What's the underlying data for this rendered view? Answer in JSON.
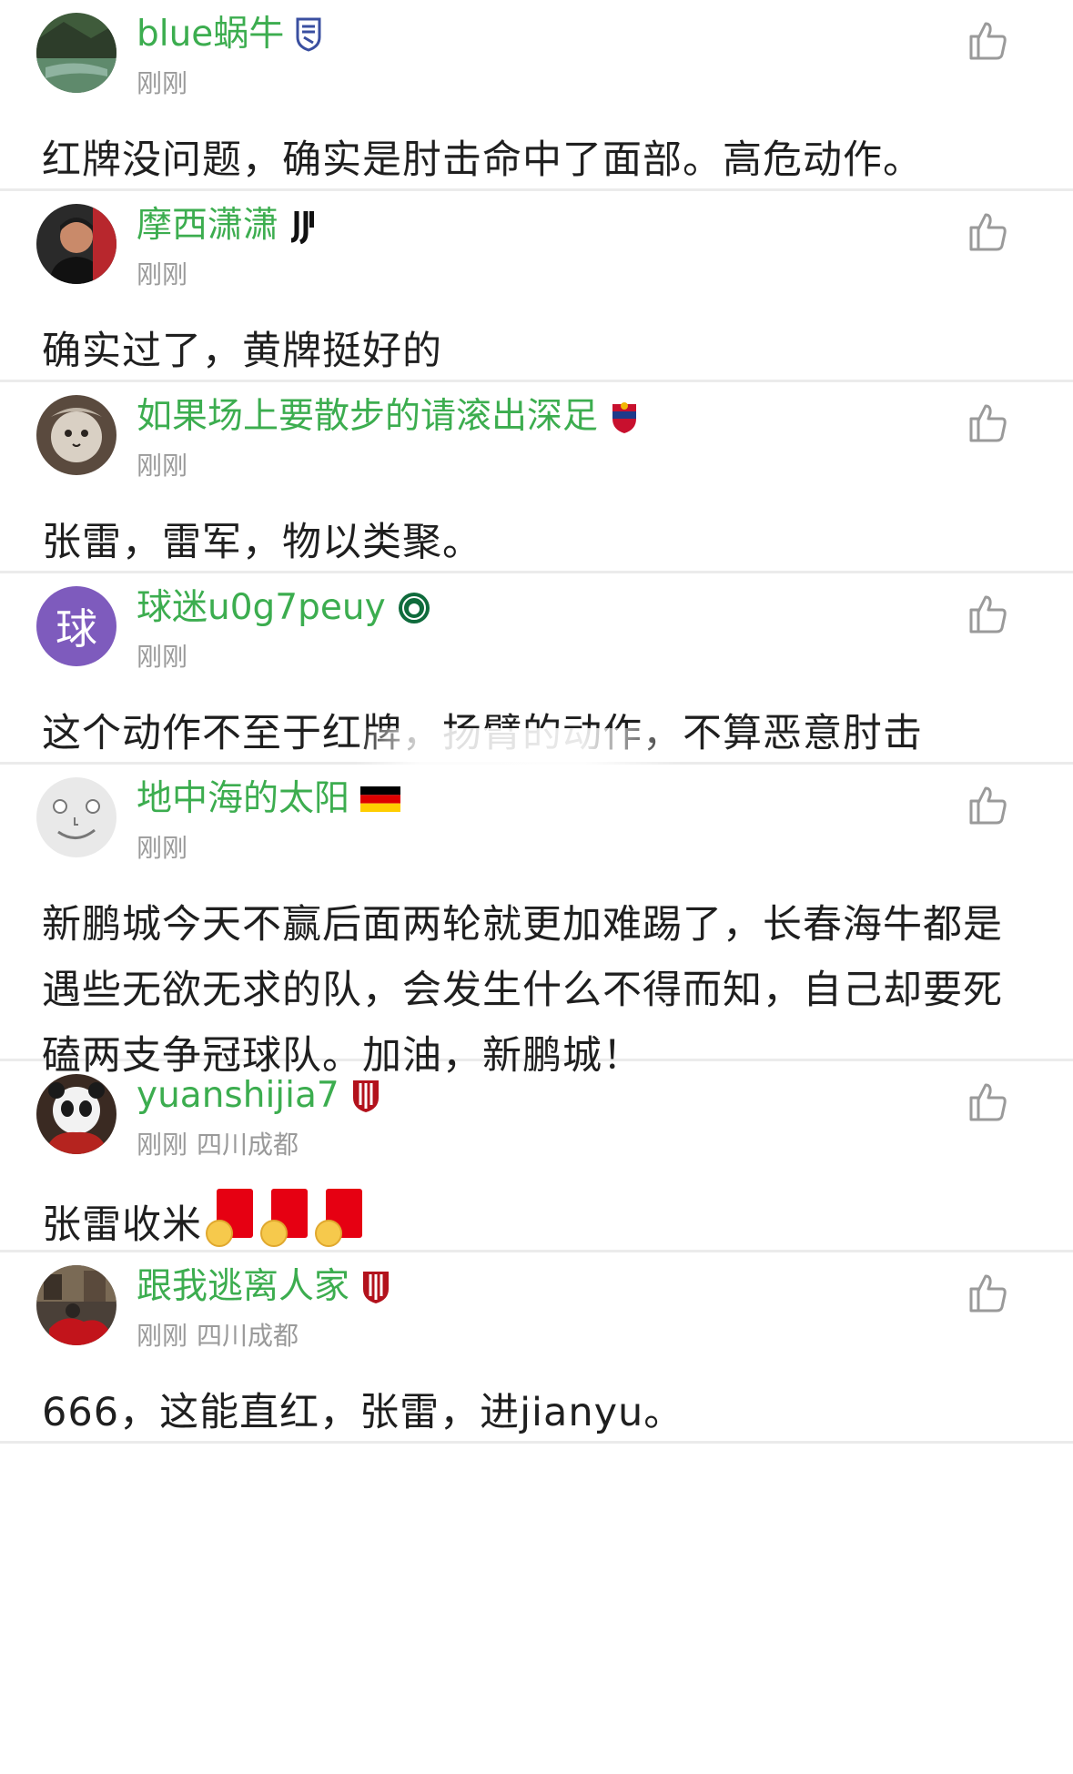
{
  "comments": [
    {
      "username": "blue蜗牛",
      "badge_icon": "shield-badge-icon",
      "time": "刚刚",
      "location": "",
      "text": "红牌没问题，确实是肘击命中了面部。高危动作。",
      "avatar": "landscape-photo"
    },
    {
      "username": "摩西潇潇",
      "badge_icon": "juventus-badge-icon",
      "time": "刚刚",
      "location": "",
      "text": "确实过了，黄牌挺好的",
      "avatar": "person-photo"
    },
    {
      "username": "如果场上要散步的请滚出深足",
      "badge_icon": "club-crest-icon",
      "time": "刚刚",
      "location": "",
      "text": "张雷，雷军，物以类聚。",
      "avatar": "cat-photo"
    },
    {
      "username": "球迷u0g7peuy",
      "badge_icon": "green-club-badge-icon",
      "time": "刚刚",
      "location": "",
      "text": "这个动作不至于红牌，扬臂的动作，不算恶意肘击",
      "avatar_letter": "球",
      "avatar_color": "#7e5bbd"
    },
    {
      "username": "地中海的太阳",
      "badge_icon": "germany-flag-icon",
      "time": "刚刚",
      "location": "",
      "text": "新鹏城今天不赢后面两轮就更加难踢了，长春海牛都是遇些无欲无求的队，会发生什么不得而知，自己却要死磕两支争冠球队。加油，新鹏城！",
      "avatar": "smiley-face"
    },
    {
      "username": "yuanshijia7",
      "badge_icon": "red-shield-badge-icon",
      "time": "刚刚",
      "location": "四川成都",
      "text": "张雷收米",
      "emoji_count": 3,
      "emoji_icon": "red-card-emoji-icon",
      "avatar": "panda-photo"
    },
    {
      "username": "跟我逃离人家",
      "badge_icon": "red-shield-badge-icon",
      "time": "刚刚",
      "location": "四川成都",
      "text": "666，这能直红，张雷，进jianyu。",
      "avatar": "street-photo"
    }
  ],
  "colors": {
    "username": "#3cad4f",
    "meta": "#9a9a9a",
    "divider": "#ebebeb",
    "text": "#1f1f1f"
  }
}
